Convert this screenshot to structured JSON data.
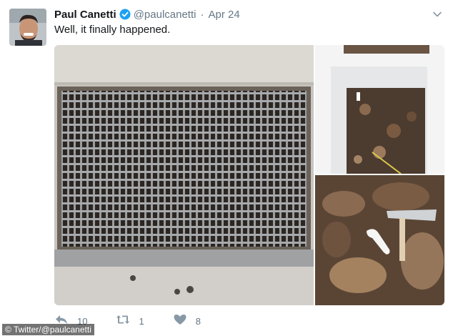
{
  "tweet": {
    "display_name": "Paul Canetti",
    "handle": "@paulcanetti",
    "separator": "·",
    "date": "Apr 24",
    "text": "Well, it finally happened.",
    "verified": true
  },
  "actions": {
    "reply_count": "10",
    "retweet_count": "1",
    "like_count": "8",
    "icons": [
      "reply-icon",
      "retweet-icon",
      "heart-icon"
    ]
  },
  "credit": "© Twitter/@paulcanetti",
  "colors": {
    "name": "#14171a",
    "secondary": "#657786",
    "verified": "#1da1f2"
  },
  "media": {
    "photos": [
      "storm drain grate on sidewalk",
      "grate opening with leaves",
      "AirPod among leaves"
    ]
  }
}
